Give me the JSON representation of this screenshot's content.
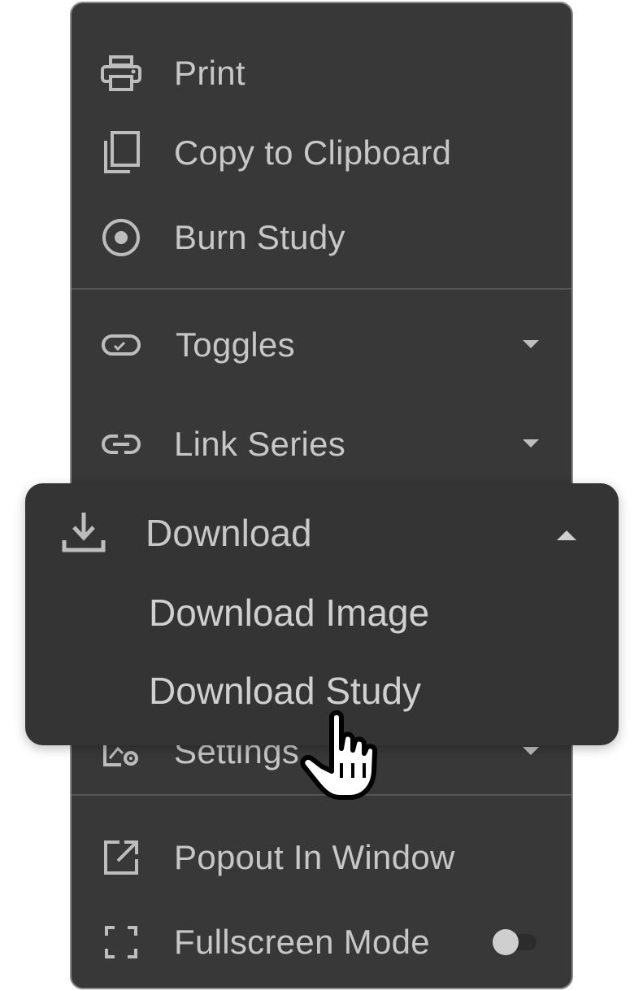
{
  "menu": {
    "items": [
      {
        "label": "Print",
        "icon": "printer-icon"
      },
      {
        "label": "Copy to Clipboard",
        "icon": "copy-icon"
      },
      {
        "label": "Burn Study",
        "icon": "disc-icon"
      },
      {
        "label": "Toggles",
        "icon": "toggle-icon"
      },
      {
        "label": "Link Series",
        "icon": "link-icon"
      },
      {
        "label": "Settings",
        "icon": "settings-icon"
      },
      {
        "label": "Popout In Window",
        "icon": "popout-icon"
      },
      {
        "label": "Fullscreen Mode",
        "icon": "fullscreen-icon"
      }
    ],
    "fullscreen_enabled": false
  },
  "download_submenu": {
    "title": "Download",
    "icon": "download-icon",
    "expanded": true,
    "options": [
      "Download Image",
      "Download Study"
    ]
  },
  "colors": {
    "menu_bg": "#383838",
    "text": "#c7c7c7",
    "border": "#8a8a8a"
  }
}
